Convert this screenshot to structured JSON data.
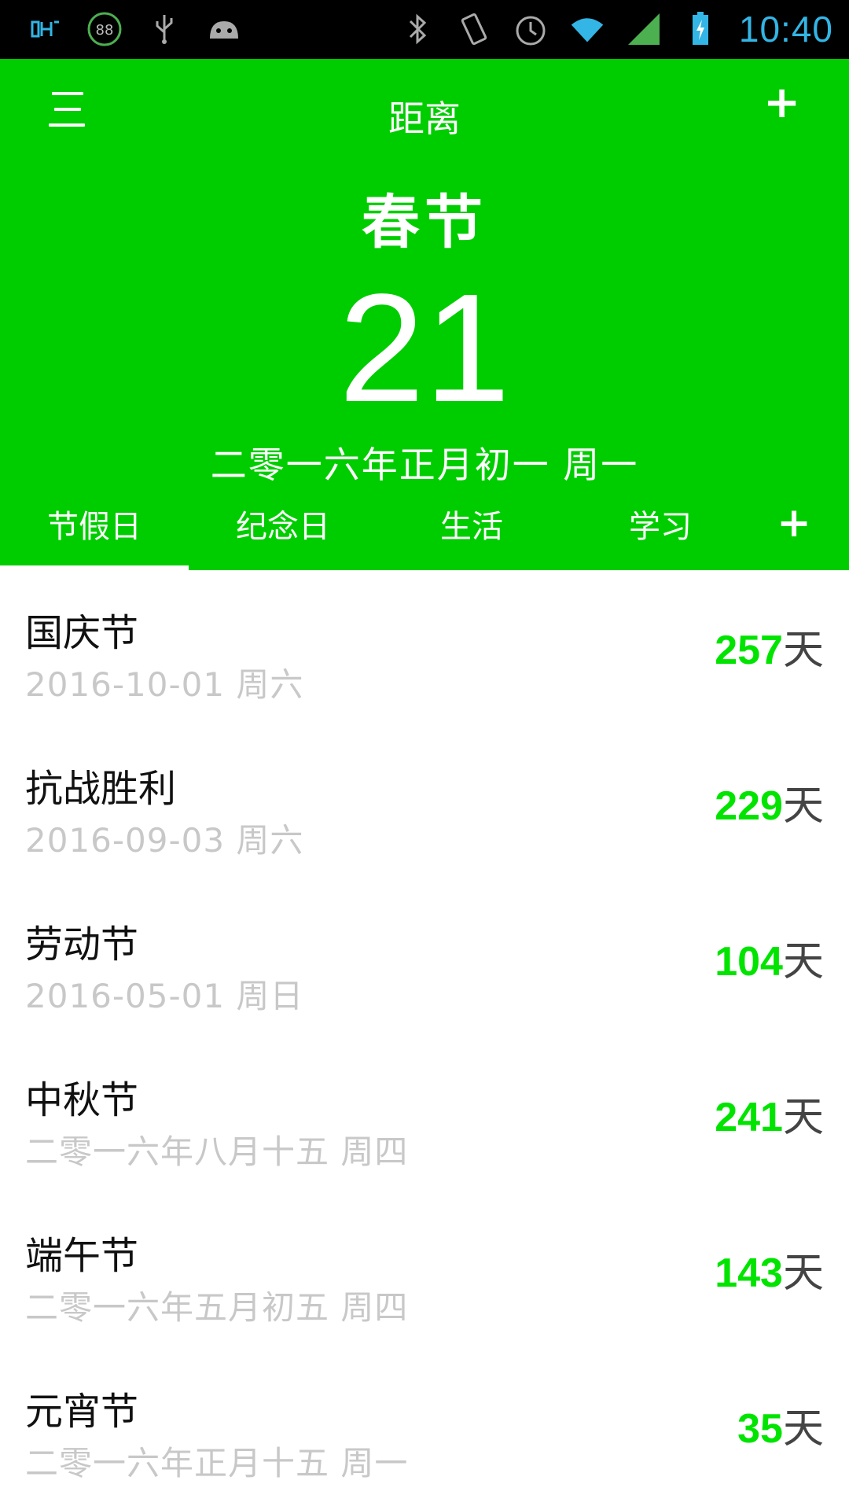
{
  "status_bar": {
    "time": "10:40",
    "badge": "88",
    "left_icons": [
      "debug-icon",
      "battery-saver-icon",
      "usb-icon",
      "android-icon"
    ],
    "right_icons": [
      "bluetooth-icon",
      "vibrate-icon",
      "alarm-icon",
      "wifi-icon",
      "signal-icon",
      "battery-charging-icon"
    ]
  },
  "header": {
    "title": "距离",
    "event_name": "春节",
    "days": "21",
    "date_text": "二零一六年正月初一 周一"
  },
  "tabs": [
    "节假日",
    "纪念日",
    "生活",
    "学习"
  ],
  "days_unit": "天",
  "items": [
    {
      "name": "国庆节",
      "date": "2016-10-01 周六",
      "days": "257"
    },
    {
      "name": "抗战胜利",
      "date": "2016-09-03 周六",
      "days": "229"
    },
    {
      "name": "劳动节",
      "date": "2016-05-01 周日",
      "days": "104"
    },
    {
      "name": "中秋节",
      "date": "二零一六年八月十五 周四",
      "days": "241"
    },
    {
      "name": "端午节",
      "date": "二零一六年五月初五 周四",
      "days": "143"
    },
    {
      "name": "元宵节",
      "date": "二零一六年正月十五 周一",
      "days": "35"
    }
  ],
  "colors": {
    "primary": "#00cd00",
    "accent": "#00e400",
    "secondary_text": "#c8c8c8"
  }
}
